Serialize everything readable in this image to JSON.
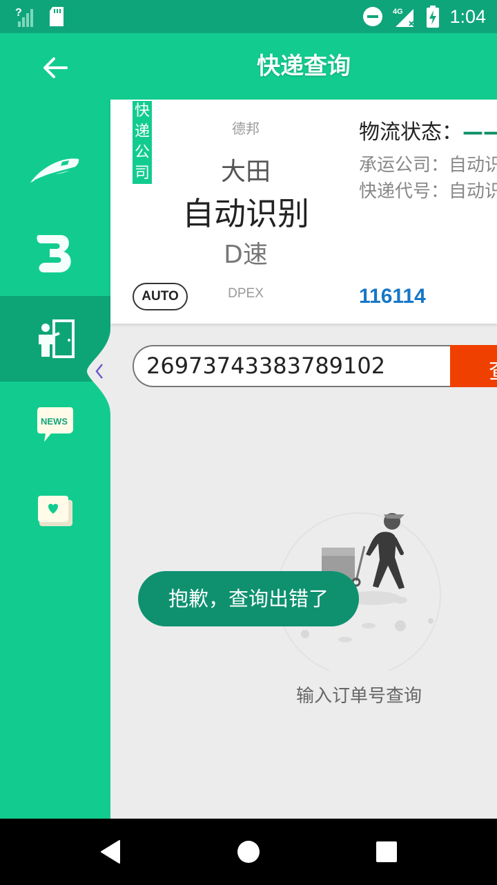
{
  "header": {
    "title": "快递查询"
  },
  "status_bar": {
    "time": "1:04",
    "network": "4G"
  },
  "card": {
    "company_tag": [
      "快",
      "递",
      "公",
      "司"
    ],
    "picker": {
      "above_2": "德邦",
      "above_1": "大田",
      "selected": "自动识别",
      "below_1": "D速"
    },
    "auto_badge": "AUTO",
    "code": "DPEX",
    "status_label": "物流状态：",
    "status_value": "——",
    "carrier_line": "承运公司：自动识别",
    "code_line": "快递代号：自动识别",
    "phone": "116114"
  },
  "search": {
    "value": "26973743383789102",
    "button_label": "查询"
  },
  "empty": {
    "hint": "输入订单号查询"
  },
  "toast": {
    "message": "抱歉，查询出错了"
  },
  "sidebar": {
    "items": [
      {
        "icon": "train-icon"
      },
      {
        "icon": "b-logo-icon"
      },
      {
        "icon": "delivery-person-icon"
      },
      {
        "icon": "news-bubble-icon"
      },
      {
        "icon": "heart-book-icon"
      }
    ],
    "active_index": 2
  },
  "colors": {
    "primary": "#12cc8f",
    "primary_dark": "#0fa57b",
    "accent": "#f04000",
    "link": "#1677c8"
  }
}
